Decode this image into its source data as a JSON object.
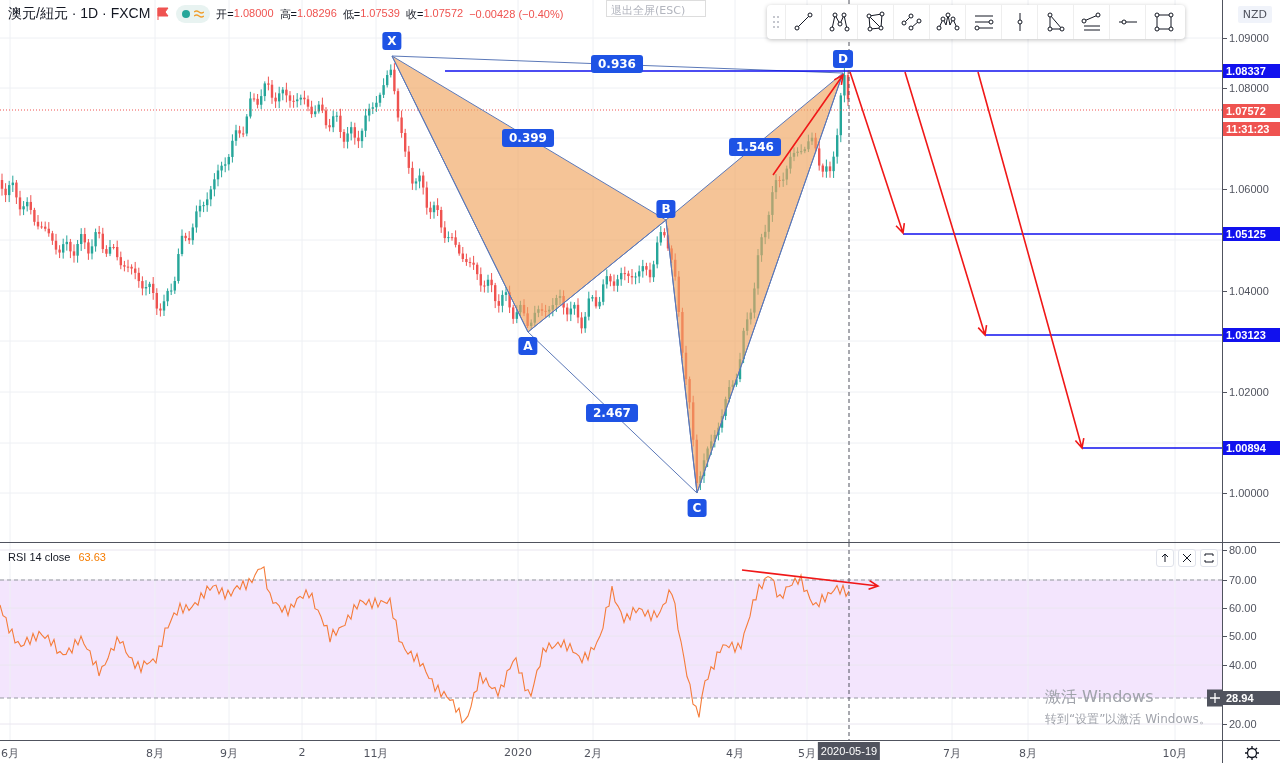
{
  "header": {
    "symbol": "澳元/紐元 · 1D · FXCM",
    "ohlc": [
      {
        "label": "开=",
        "value": "1.08000"
      },
      {
        "label": "高=",
        "value": "1.08296"
      },
      {
        "label": "低=",
        "value": "1.07539"
      },
      {
        "label": "收=",
        "value": "1.07572"
      }
    ],
    "change": "−0.00428 (−0.40%)"
  },
  "fullscreen_tooltip": "退出全屏(ESC)",
  "toolbar": {
    "tools": [
      {
        "kind": "line"
      },
      {
        "kind": "xabcd"
      },
      {
        "kind": "quad"
      },
      {
        "kind": "segments"
      },
      {
        "kind": "peaks"
      },
      {
        "kind": "lines"
      },
      {
        "kind": "vertical"
      },
      {
        "kind": "triangle"
      },
      {
        "kind": "fan"
      },
      {
        "kind": "horizontal"
      },
      {
        "kind": "rectangle"
      }
    ]
  },
  "pattern": {
    "points": [
      "X",
      "A",
      "B",
      "C",
      "D"
    ],
    "ratios": [
      "0.936",
      "0.399",
      "1.546",
      "2.467"
    ]
  },
  "price_axis": {
    "currency": "NZD",
    "ticks": [
      "1.09000",
      "1.08000",
      "1.06000",
      "1.04000",
      "1.02000",
      "1.00000"
    ],
    "level_labels": [
      "1.08337",
      "1.05125",
      "1.03123",
      "1.00894"
    ],
    "last_price": "1.07572",
    "countdown": "11:31:23"
  },
  "rsi": {
    "title": "RSI 14 close",
    "value": "63.63",
    "ticks": [
      "80.00",
      "70.00",
      "60.00",
      "50.00",
      "40.00",
      "20.00"
    ],
    "crosshair_value": "28.94",
    "buttons": [
      {
        "kind": "up"
      },
      {
        "kind": "close"
      },
      {
        "kind": "maximize"
      }
    ]
  },
  "windows_notice": {
    "title": "激活 Windows",
    "message": "转到“设置”以激活 Windows。"
  },
  "time_axis": {
    "labels": [
      "6月",
      "8月",
      "9月",
      "2",
      "11月",
      "2020",
      "2月",
      "4月",
      "5月",
      "7月",
      "8月",
      "10月"
    ],
    "crosshair_date": "2020-05-19"
  }
}
